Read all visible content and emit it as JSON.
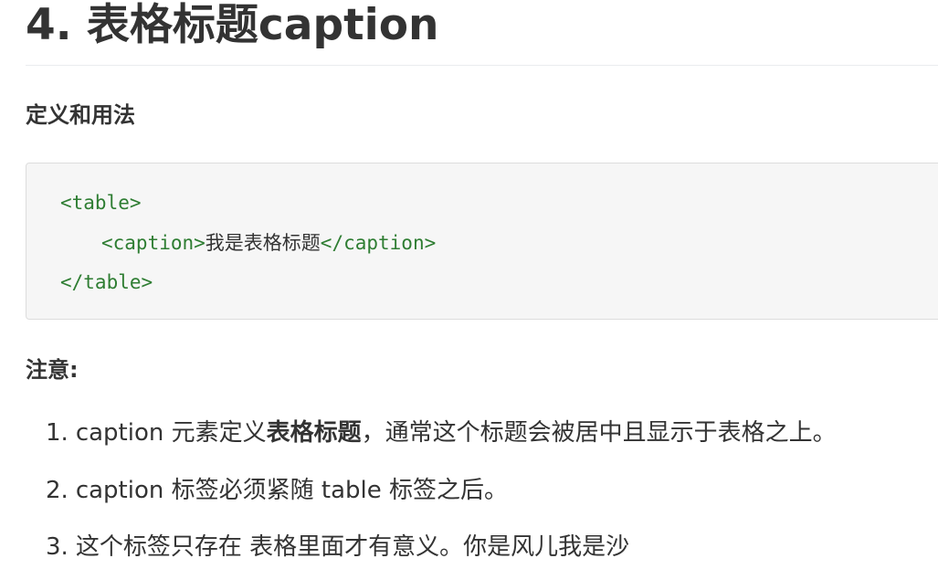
{
  "heading": {
    "title": "4. 表格标题caption"
  },
  "sections": {
    "definition": "定义和用法",
    "note": "注意:"
  },
  "code": {
    "line1": "<table>",
    "line2_open": "<caption>",
    "line2_text": "我是表格标题",
    "line2_close": "</caption>",
    "line3": "</table>"
  },
  "notes": [
    {
      "number": "1.",
      "before": "caption 元素定义",
      "strong": "表格标题",
      "after": "，通常这个标题会被居中且显示于表格之上。"
    },
    {
      "number": "2.",
      "text": "caption 标签必须紧随 table 标签之后。"
    },
    {
      "number": "3.",
      "text": "这个标签只存在 表格里面才有意义。你是风儿我是沙"
    }
  ],
  "colors": {
    "code_tag": "#2e7d32",
    "code_bg": "#f6f6f6",
    "text": "#333333"
  }
}
